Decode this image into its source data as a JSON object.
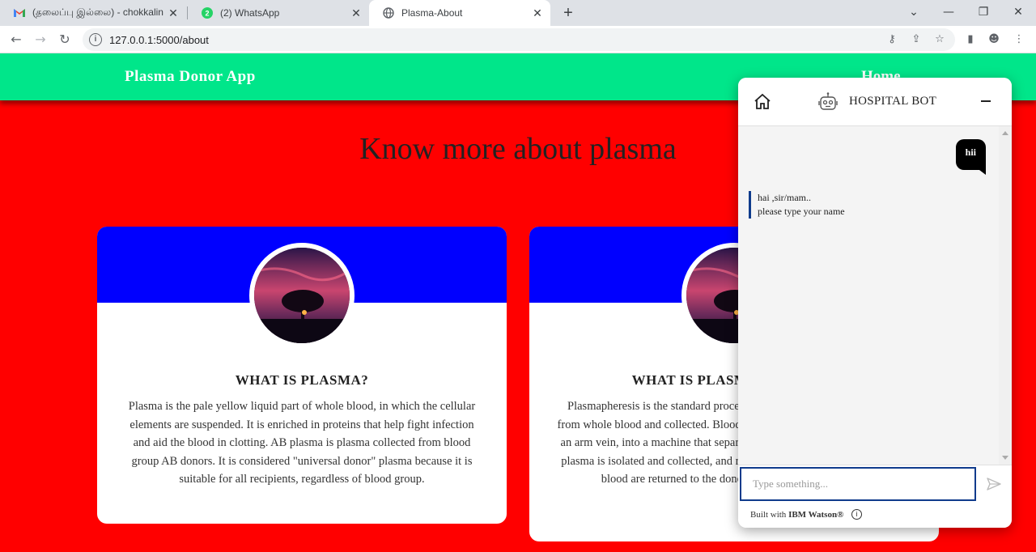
{
  "browser": {
    "tabs": [
      {
        "title": "(தலைப்பு இல்லை) - chokkalin",
        "favicon": "gmail-icon"
      },
      {
        "title": "(2) WhatsApp",
        "favicon": "whatsapp-icon",
        "badge": "2"
      },
      {
        "title": "Plasma-About",
        "favicon": "globe-icon",
        "active": true
      }
    ],
    "url": "127.0.0.1:5000/about",
    "colors": {
      "tabstrip": "#dee1e6",
      "omnibox": "#f1f3f4"
    }
  },
  "site": {
    "brand": "Plasma Donor App",
    "nav_home": "Home",
    "heading": "Know more about plasma",
    "colors": {
      "navbar": "#00e68a",
      "background": "#ff0000",
      "card_banner": "#0000ff"
    },
    "cards": [
      {
        "title": "WHAT IS PLASMA?",
        "text": "Plasma is the pale yellow liquid part of whole blood, in which the cellular elements are suspended. It is enriched in proteins that help fight infection and aid the blood in clotting. AB plasma is plasma collected from blood group AB donors. It is considered \"universal donor\" plasma because it is suitable for all recipients, regardless of blood group."
      },
      {
        "title": "WHAT IS PLASMAPHERESIS?",
        "text": "Plasmapheresis is the standard procedure by which plasma is separated from whole blood and collected. Blood is drawn through a needle placed in an arm vein, into a machine that separates it using a sterile plastic kit. The plasma is isolated and collected, and red blood cells and other parts of the blood are returned to the donor through the same needle."
      }
    ]
  },
  "chatbot": {
    "title": "HOSPITAL BOT",
    "user_message": "hii",
    "bot_line1": "hai ,sir/mam..",
    "bot_line2": "please type your name",
    "input_placeholder": "Type something...",
    "footer_prefix": "Built with",
    "footer_brand": "IBM Watson®",
    "help_label": "?",
    "colors": {
      "accent": "#0f3b8c"
    }
  }
}
